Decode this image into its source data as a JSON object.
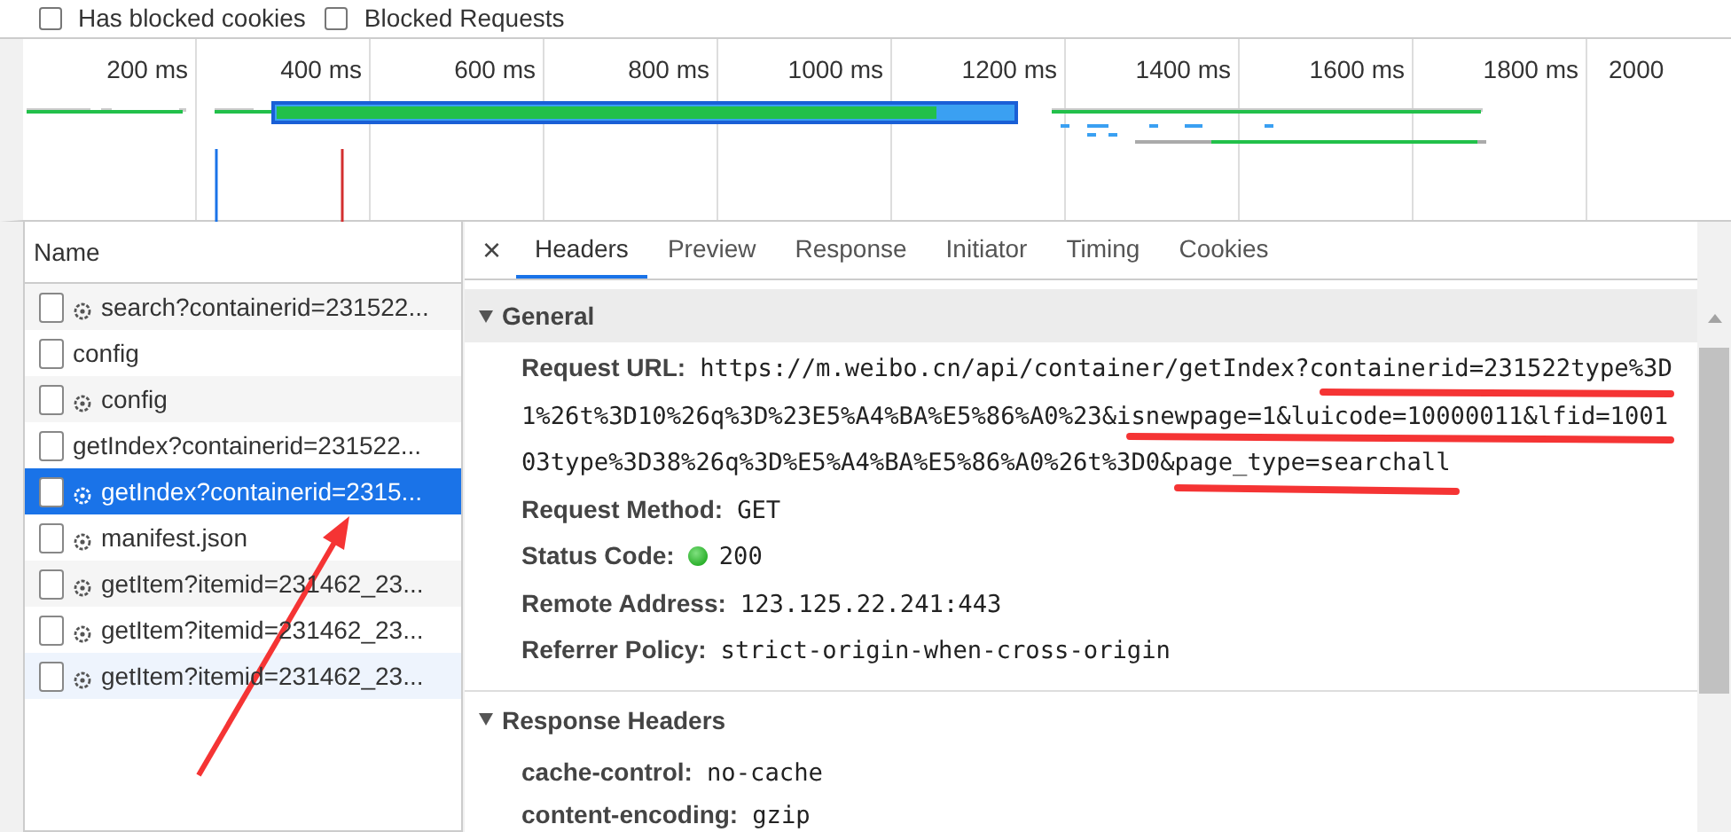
{
  "filters": [
    {
      "label": "Has blocked cookies",
      "checked": false
    },
    {
      "label": "Blocked Requests",
      "checked": false
    }
  ],
  "overview": {
    "ticks": [
      "200 ms",
      "400 ms",
      "600 ms",
      "800 ms",
      "1000 ms",
      "1200 ms",
      "1400 ms",
      "1600 ms",
      "1800 ms",
      "2000"
    ]
  },
  "request_list": {
    "header": "Name",
    "rows": [
      {
        "name": "search?containerid=231522...",
        "gear": true,
        "selected": false,
        "hovered": false
      },
      {
        "name": "config",
        "gear": false,
        "selected": false,
        "hovered": false
      },
      {
        "name": "config",
        "gear": true,
        "selected": false,
        "hovered": false
      },
      {
        "name": "getIndex?containerid=231522...",
        "gear": false,
        "selected": false,
        "hovered": false
      },
      {
        "name": "getIndex?containerid=2315...",
        "gear": true,
        "selected": true,
        "hovered": false
      },
      {
        "name": "manifest.json",
        "gear": true,
        "selected": false,
        "hovered": false
      },
      {
        "name": "getItem?itemid=231462_23...",
        "gear": true,
        "selected": false,
        "hovered": false
      },
      {
        "name": "getItem?itemid=231462_23...",
        "gear": true,
        "selected": false,
        "hovered": false
      },
      {
        "name": "getItem?itemid=231462_23...",
        "gear": true,
        "selected": false,
        "hovered": true
      }
    ]
  },
  "details": {
    "close": "×",
    "tabs": [
      {
        "label": "Headers",
        "selected": true
      },
      {
        "label": "Preview",
        "selected": false
      },
      {
        "label": "Response",
        "selected": false
      },
      {
        "label": "Initiator",
        "selected": false
      },
      {
        "label": "Timing",
        "selected": false
      },
      {
        "label": "Cookies",
        "selected": false
      }
    ],
    "sections": [
      {
        "title": "General",
        "expanded": true,
        "rows": [
          {
            "key": "Request URL:",
            "lines": [
              "https://m.weibo.cn/api/container/getIndex?containerid=231522type%3D",
              "1%26t%3D10%26q%3D%23E5%A4%BA%E5%86%A0%23&isnewpage=1&luicode=10000011&lfid=1001",
              "03type%3D38%26q%3D%E5%A4%BA%E5%86%A0%26t%3D0&page_type=searchall"
            ],
            "kind": "wrapped"
          },
          {
            "key": "Request Method:",
            "value": "GET",
            "kind": "text"
          },
          {
            "key": "Status Code:",
            "value": "200",
            "kind": "status"
          },
          {
            "key": "Remote Address:",
            "value": "123.125.22.241:443",
            "kind": "text"
          },
          {
            "key": "Referrer Policy:",
            "value": "strict-origin-when-cross-origin",
            "kind": "text"
          }
        ]
      },
      {
        "title": "Response Headers",
        "expanded": true,
        "rows": [
          {
            "key": "cache-control:",
            "value": "no-cache",
            "kind": "text"
          },
          {
            "key": "content-encoding:",
            "value": "gzip",
            "kind": "text"
          }
        ]
      }
    ]
  }
}
